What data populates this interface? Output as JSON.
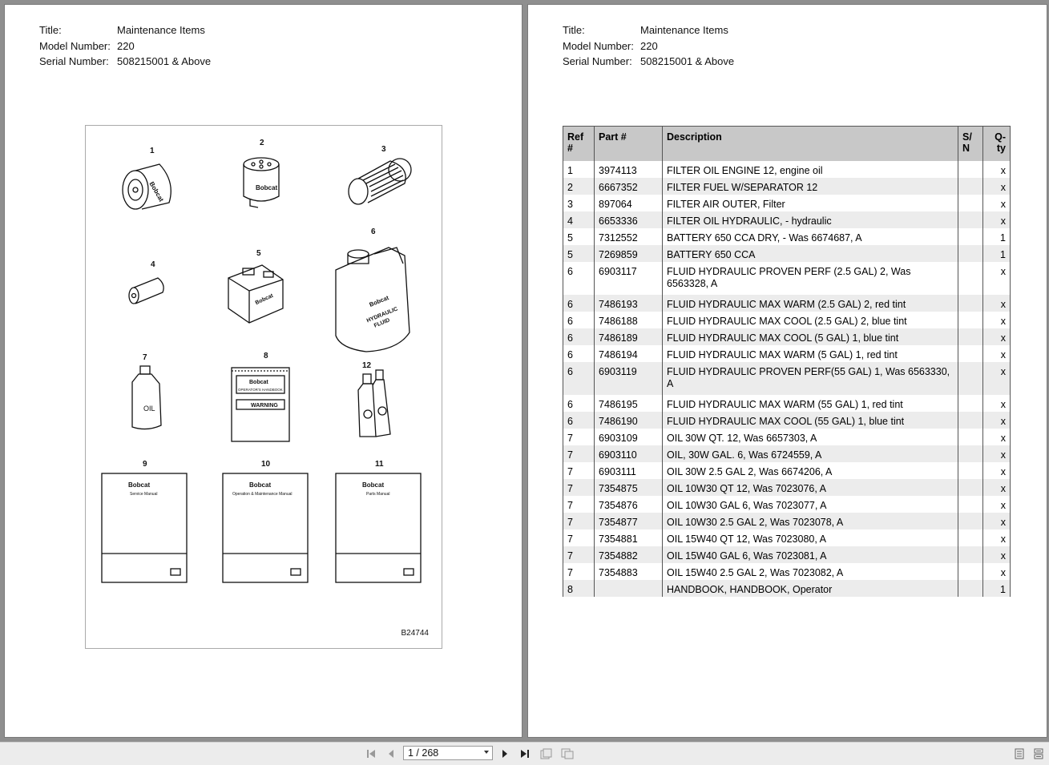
{
  "header": {
    "title_label": "Title:",
    "title_value": "Maintenance Items",
    "model_label": "Model Number:",
    "model_value": "220",
    "serial_label": "Serial Number:",
    "serial_value": "508215001 & Above"
  },
  "figure": {
    "id": "B24744",
    "callouts": [
      "1",
      "2",
      "3",
      "4",
      "5",
      "6",
      "7",
      "8",
      "12",
      "9",
      "10",
      "11"
    ],
    "brand": "Bobcat",
    "labels": {
      "hydraulic_line1": "HYDRAULIC",
      "hydraulic_line2": "FLUID",
      "oil": "OIL",
      "operators_handbook": "OPERATOR'S HANDBOOK",
      "warning": "WARNING",
      "service_manual": "Service Manual",
      "op_maint_manual": "Operation & Maintenance Manual",
      "parts_manual": "Parts Manual"
    }
  },
  "table": {
    "headers": {
      "ref": "Ref #",
      "part": "Part #",
      "description": "Description",
      "sn": "S/ N",
      "qty": "Q- ty"
    },
    "rows": [
      {
        "ref": "1",
        "part": "3974113",
        "desc": "FILTER OIL ENGINE 12, engine oil",
        "sn": "",
        "qty": "x"
      },
      {
        "ref": "2",
        "part": "6667352",
        "desc": "FILTER FUEL W/SEPARATOR 12",
        "sn": "",
        "qty": "x"
      },
      {
        "ref": "3",
        "part": "897064",
        "desc": "FILTER AIR OUTER, Filter",
        "sn": "",
        "qty": "x"
      },
      {
        "ref": "4",
        "part": "6653336",
        "desc": "FILTER OIL HYDRAULIC, - hydraulic",
        "sn": "",
        "qty": "x"
      },
      {
        "ref": "5",
        "part": "7312552",
        "desc": "BATTERY 650 CCA DRY,  - Was 6674687, A",
        "sn": "",
        "qty": "1"
      },
      {
        "ref": "5",
        "part": "7269859",
        "desc": "BATTERY 650 CCA",
        "sn": "",
        "qty": "1"
      },
      {
        "ref": "6",
        "part": "6903117",
        "desc": "FLUID HYDRAULIC PROVEN PERF (2.5 GAL) 2, Was 6563328, A",
        "sn": "",
        "qty": "x"
      },
      {
        "ref": "6",
        "part": "7486193",
        "desc": "FLUID HYDRAULIC MAX WARM (2.5 GAL) 2, red tint",
        "sn": "",
        "qty": "x"
      },
      {
        "ref": "6",
        "part": "7486188",
        "desc": "FLUID HYDRAULIC MAX COOL (2.5 GAL) 2, blue tint",
        "sn": "",
        "qty": "x"
      },
      {
        "ref": "6",
        "part": "7486189",
        "desc": "FLUID HYDRAULIC MAX COOL (5 GAL) 1, blue tint",
        "sn": "",
        "qty": "x"
      },
      {
        "ref": "6",
        "part": "7486194",
        "desc": "FLUID HYDRAULIC MAX WARM (5 GAL) 1, red tint",
        "sn": "",
        "qty": "x"
      },
      {
        "ref": "6",
        "part": "6903119",
        "desc": "FLUID HYDRAULIC PROVEN PERF(55 GAL) 1, Was 6563330, A",
        "sn": "",
        "qty": "x"
      },
      {
        "ref": "6",
        "part": "7486195",
        "desc": "FLUID HYDRAULIC MAX WARM (55 GAL) 1, red tint",
        "sn": "",
        "qty": "x"
      },
      {
        "ref": "6",
        "part": "7486190",
        "desc": "FLUID HYDRAULIC MAX COOL (55 GAL) 1, blue tint",
        "sn": "",
        "qty": "x"
      },
      {
        "ref": "7",
        "part": "6903109",
        "desc": "OIL  30W  QT. 12, Was 6657303, A",
        "sn": "",
        "qty": "x"
      },
      {
        "ref": "7",
        "part": "6903110",
        "desc": "OIL, 30W  GAL.  6, Was 6724559, A",
        "sn": "",
        "qty": "x"
      },
      {
        "ref": "7",
        "part": "6903111",
        "desc": "OIL  30W  2.5 GAL  2, Was 6674206, A",
        "sn": "",
        "qty": "x"
      },
      {
        "ref": "7",
        "part": "7354875",
        "desc": "OIL 10W30 QT 12, Was 7023076, A",
        "sn": "",
        "qty": "x"
      },
      {
        "ref": "7",
        "part": "7354876",
        "desc": "OIL 10W30 GAL 6, Was 7023077, A",
        "sn": "",
        "qty": "x"
      },
      {
        "ref": "7",
        "part": "7354877",
        "desc": "OIL 10W30 2.5 GAL 2, Was 7023078, A",
        "sn": "",
        "qty": "x"
      },
      {
        "ref": "7",
        "part": "7354881",
        "desc": "OIL 15W40 QT 12, Was 7023080, A",
        "sn": "",
        "qty": "x"
      },
      {
        "ref": "7",
        "part": "7354882",
        "desc": "OIL 15W40 GAL 6, Was 7023081, A",
        "sn": "",
        "qty": "x"
      },
      {
        "ref": "7",
        "part": "7354883",
        "desc": "OIL 15W40 2.5 GAL 2, Was 7023082, A",
        "sn": "",
        "qty": "x"
      },
      {
        "ref": "8",
        "part": "",
        "desc": "HANDBOOK, HANDBOOK, Operator",
        "sn": "",
        "qty": "1"
      }
    ]
  },
  "toolbar": {
    "page_indicator": "1 / 268",
    "icons": [
      "first-page-icon",
      "prev-page-icon",
      "next-page-icon",
      "last-page-icon",
      "single-page-view-icon",
      "dual-page-view-icon",
      "thumbnail-view-icon",
      "outline-view-icon"
    ]
  }
}
